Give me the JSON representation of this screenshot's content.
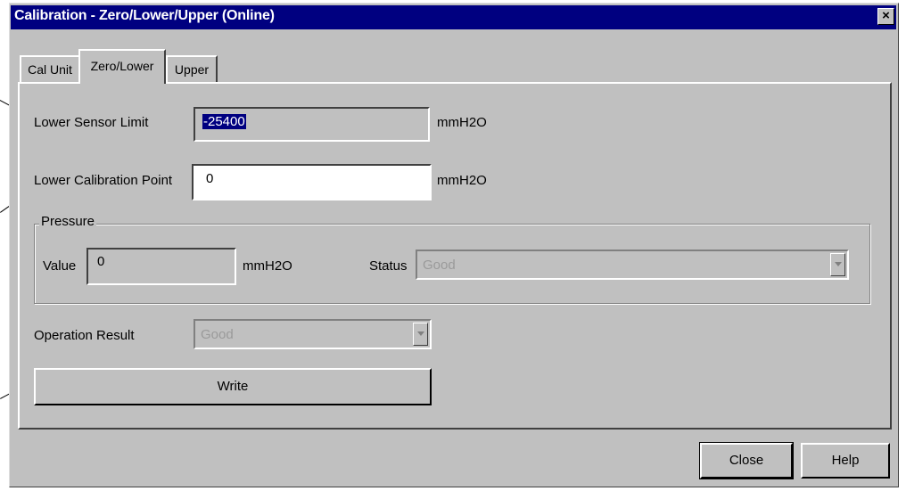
{
  "window": {
    "title": "Calibration - Zero/Lower/Upper  (Online)",
    "close_glyph": "×"
  },
  "tabs": [
    {
      "label": "Cal Unit"
    },
    {
      "label": "Zero/Lower"
    },
    {
      "label": "Upper"
    }
  ],
  "form": {
    "lower_sensor_limit": {
      "label": "Lower Sensor Limit",
      "value": "-25400",
      "unit": "mmH2O"
    },
    "lower_calibration_point": {
      "label": "Lower Calibration Point",
      "value": "0",
      "unit": "mmH2O"
    }
  },
  "pressure": {
    "title": "Pressure",
    "value_label": "Value",
    "value": "0",
    "unit": "mmH2O",
    "status_label": "Status",
    "status_value": "Good"
  },
  "operation_result": {
    "label": "Operation Result",
    "value": "Good"
  },
  "buttons": {
    "write": "Write",
    "close": "Close",
    "help": "Help"
  }
}
